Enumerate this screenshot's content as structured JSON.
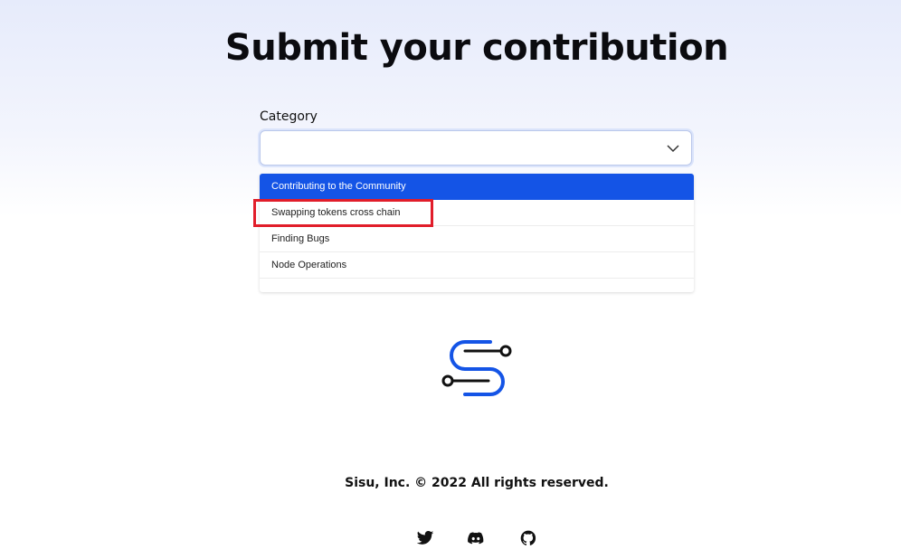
{
  "page": {
    "title": "Submit your contribution"
  },
  "form": {
    "category_label": "Category",
    "category_value": "",
    "options": [
      "Contributing to the Community",
      "Swapping tokens cross chain",
      "Finding Bugs",
      "Node Operations"
    ],
    "selected_index": 0,
    "highlighted_index": 1
  },
  "brand": {
    "logo_icon": "sisu-logo-icon",
    "accent_color": "#1454e6"
  },
  "footer": {
    "copyright": "Sisu, Inc. © 2022 All rights reserved.",
    "social": [
      "twitter-icon",
      "discord-icon",
      "github-icon"
    ]
  },
  "colors": {
    "selected_option_bg": "#1454e6",
    "annotation_box": "#e11d2a"
  }
}
